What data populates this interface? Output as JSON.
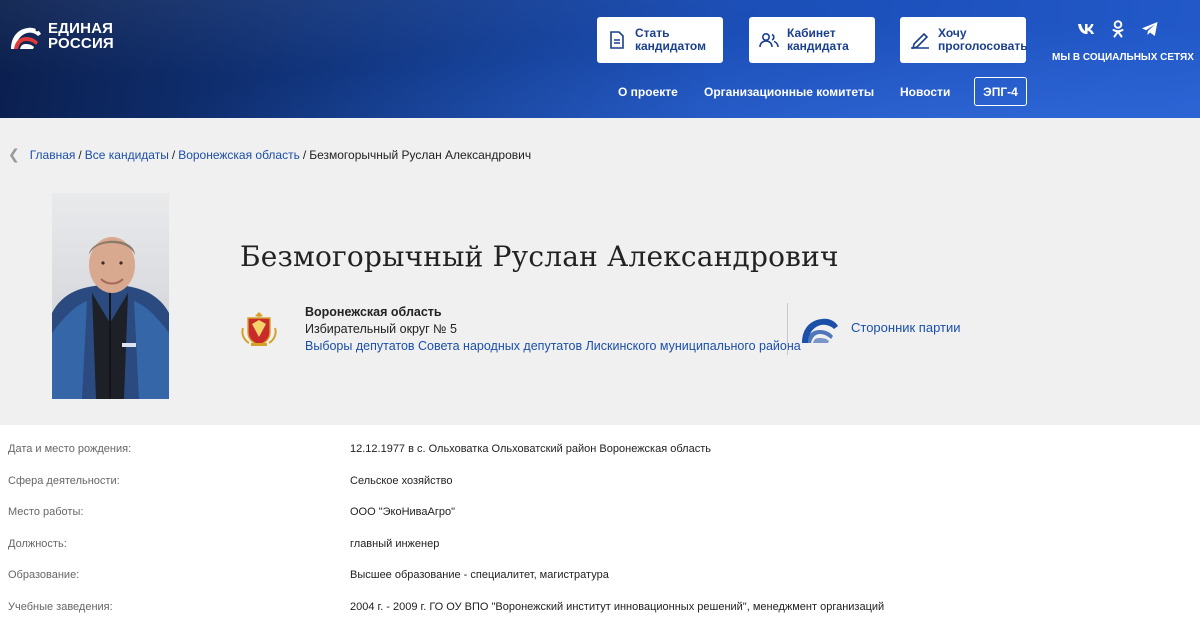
{
  "header": {
    "logo": {
      "line1": "ЕДИНАЯ",
      "line2": "РОССИЯ"
    },
    "buttons": [
      {
        "label": "Стать\nкандидатом",
        "icon": "document-icon"
      },
      {
        "label": "Кабинет\nкандидата",
        "icon": "users-icon"
      },
      {
        "label": "Хочу\nпроголосовать",
        "icon": "pen-vote-icon"
      }
    ],
    "nav": [
      {
        "label": "О проекте"
      },
      {
        "label": "Организационные комитеты"
      },
      {
        "label": "Новости"
      }
    ],
    "epg_label": "ЭПГ-4",
    "social": {
      "icons": [
        "vk-icon",
        "ok-icon",
        "telegram-icon"
      ],
      "caption": "МЫ В СОЦИАЛЬНЫХ СЕТЯХ"
    }
  },
  "breadcrumb": {
    "items": [
      "Главная",
      "Все кандидаты",
      "Воронежская область"
    ],
    "current": "Безмогорычный Руслан Александрович",
    "separator": "/"
  },
  "profile": {
    "name": "Безмогорычный Руслан Александрович",
    "region": "Воронежская область",
    "district": "Избирательный округ № 5",
    "election": "Выборы депутатов Совета народных депутатов Лискинского муниципального района",
    "status": "Сторонник партии"
  },
  "info": [
    {
      "key": "Дата и место рождения:",
      "value": "12.12.1977 в с. Ольховатка Ольховатский район Воронежская область"
    },
    {
      "key": "Сфера деятельности:",
      "value": "Сельское хозяйство"
    },
    {
      "key": "Место работы:",
      "value": "ООО \"ЭкоНиваАгро\""
    },
    {
      "key": "Должность:",
      "value": "главный инженер"
    },
    {
      "key": "Образование:",
      "value": "Высшее образование - специалитет, магистратура"
    },
    {
      "key": "Учебные заведения:",
      "value": "2004 г. - 2009 г. ГО ОУ ВПО \"Воронежский институт инновационных решений\", менеджмент организаций"
    }
  ],
  "colors": {
    "header_dark": "#0b1f4d",
    "header_light": "#2259c9",
    "link_blue": "#1b4fa8",
    "profile_bg": "#f0f0f1"
  }
}
